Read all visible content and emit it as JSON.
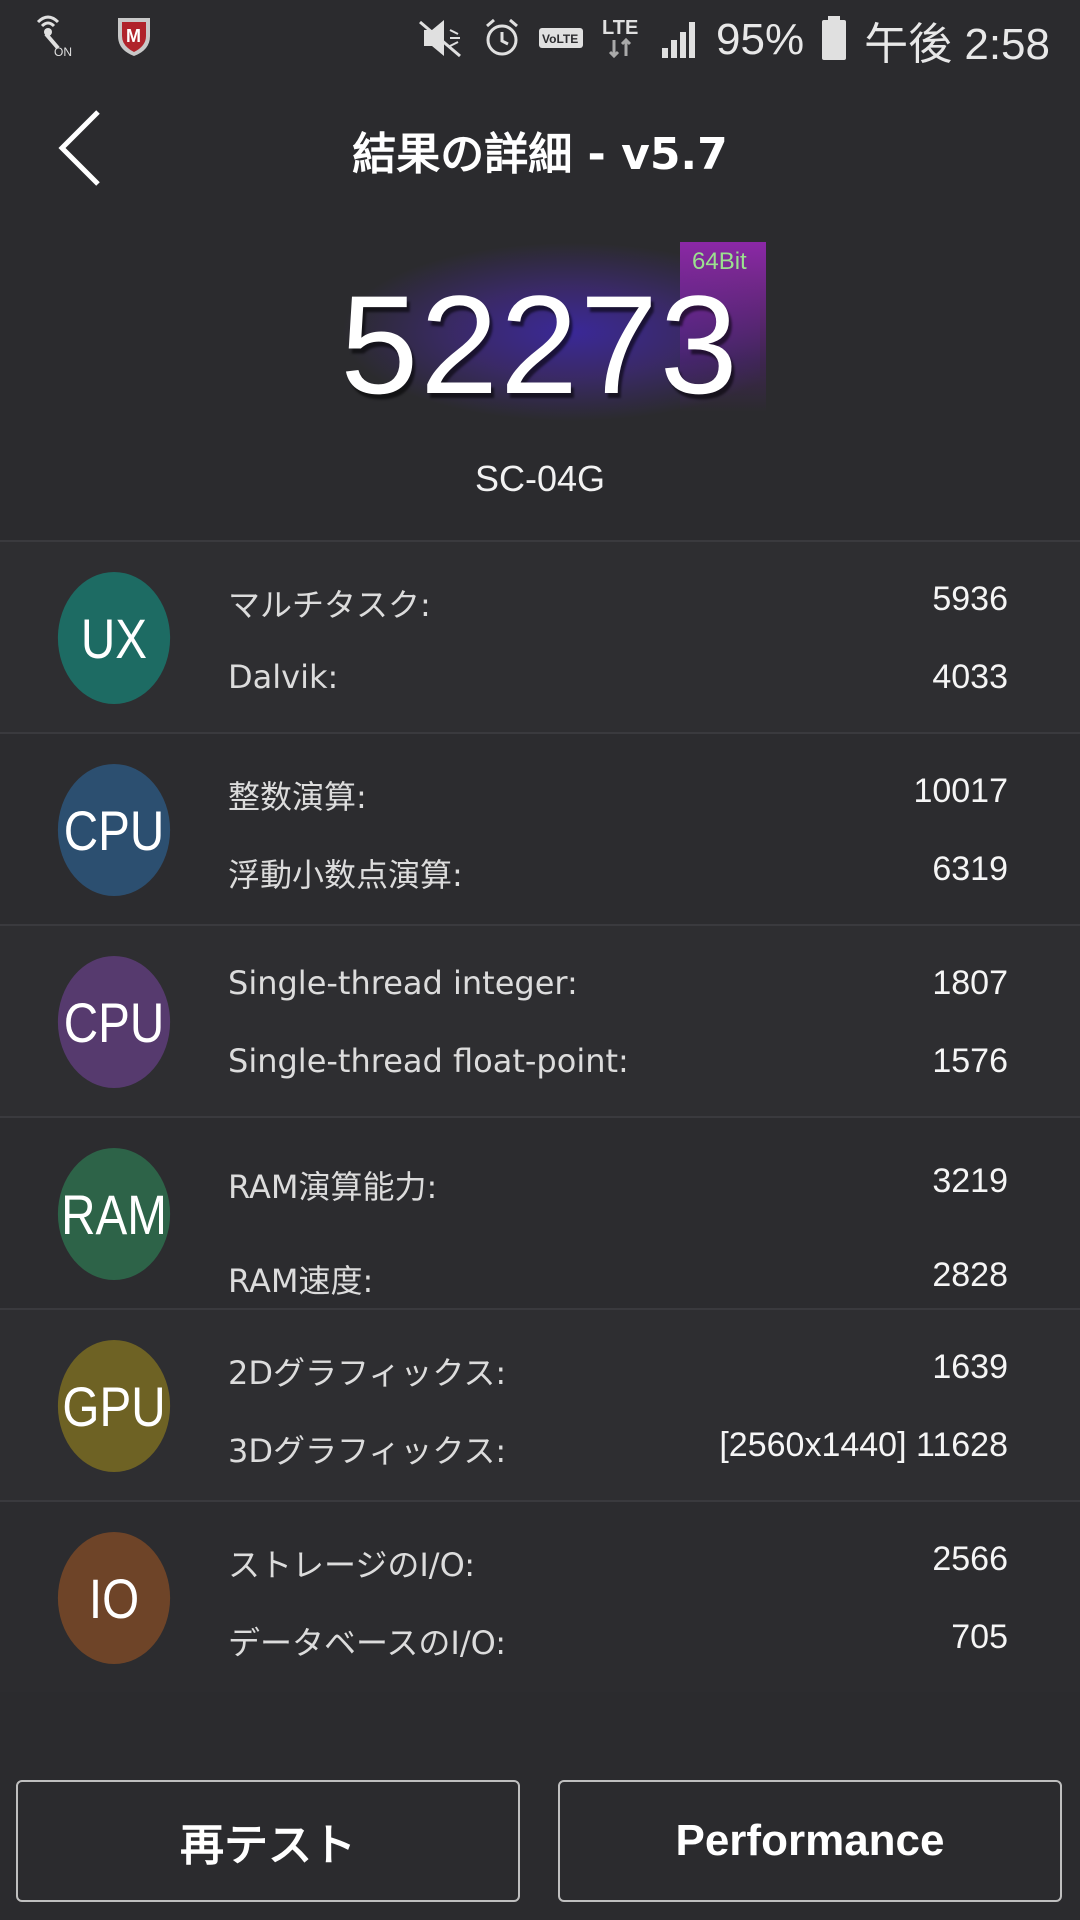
{
  "status_bar": {
    "battery_percent": "95%",
    "time": "午後 2:58",
    "network_label": "LTE",
    "volte_label": "VoLTE",
    "nfc_label": "ON",
    "icons": [
      "nfc-icon",
      "mcafee-icon",
      "mute-icon",
      "alarm-icon",
      "volte-icon",
      "lte-icon",
      "signal-icon",
      "battery-icon"
    ]
  },
  "header": {
    "title": "結果の詳細 - v5.7"
  },
  "score": {
    "total": "52273",
    "bit_label": "64Bit",
    "device": "SC-04G"
  },
  "categories": [
    {
      "badge": "UX",
      "color": "#1d6b63",
      "metrics": [
        {
          "label": "マルチタスク:",
          "value": "5936"
        },
        {
          "label": "Dalvik:",
          "value": "4033"
        }
      ]
    },
    {
      "badge": "CPU",
      "color": "#2c4f70",
      "metrics": [
        {
          "label": "整数演算:",
          "value": "10017"
        },
        {
          "label": "浮動小数点演算:",
          "value": "6319"
        }
      ]
    },
    {
      "badge": "CPU",
      "color": "#563a6e",
      "metrics": [
        {
          "label": "Single-thread integer:",
          "value": "1807"
        },
        {
          "label": "Single-thread float-point:",
          "value": "1576"
        }
      ]
    },
    {
      "badge": "RAM",
      "color": "#2d6348",
      "metrics": [
        {
          "label": "RAM演算能力:",
          "value": "3219"
        },
        {
          "label": "RAM速度:",
          "value": "2828"
        }
      ]
    },
    {
      "badge": "GPU",
      "color": "#6e6224",
      "metrics": [
        {
          "label": "2Dグラフィックス:",
          "value": "1639"
        },
        {
          "label": "3Dグラフィックス:",
          "value": "[2560x1440] 11628"
        }
      ]
    },
    {
      "badge": "IO",
      "color": "#6e4428",
      "metrics": [
        {
          "label": "ストレージのI/O:",
          "value": "2566"
        },
        {
          "label": "データベースのI/O:",
          "value": "705"
        }
      ]
    }
  ],
  "buttons": {
    "retest": "再テスト",
    "performance": "Performance"
  }
}
